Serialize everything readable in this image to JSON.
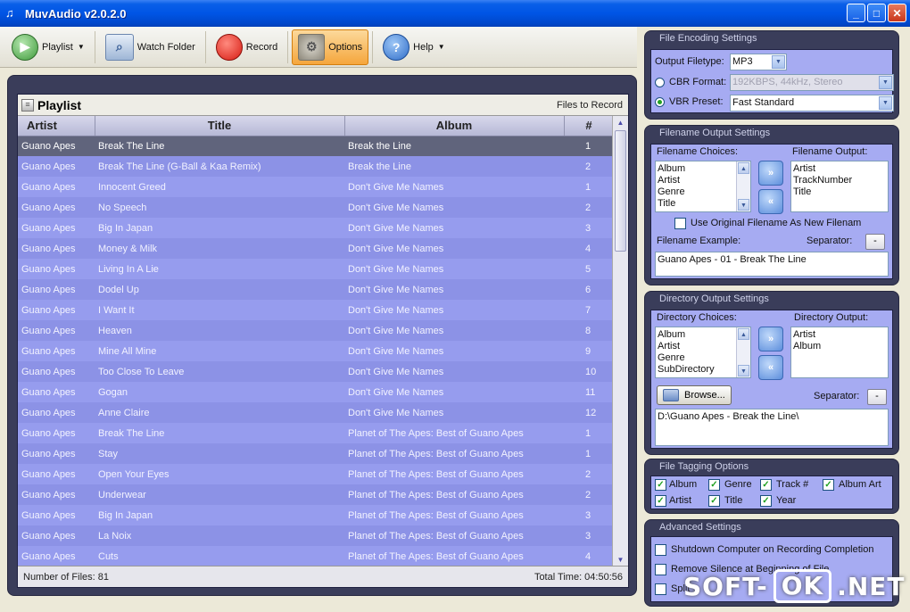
{
  "window": {
    "title": "MuvAudio v2.0.2.0"
  },
  "toolbar": {
    "playlist": "Playlist",
    "watch_folder": "Watch Folder",
    "record": "Record",
    "options": "Options",
    "help": "Help"
  },
  "playlist": {
    "title": "Playlist",
    "files_to_record": "Files to Record",
    "columns": {
      "artist": "Artist",
      "title": "Title",
      "album": "Album",
      "num": "#"
    },
    "rows": [
      [
        "Guano Apes",
        "Break The Line",
        "Break the Line",
        "1"
      ],
      [
        "Guano Apes",
        "Break The Line (G-Ball & Kaa Remix)",
        "Break the Line",
        "2"
      ],
      [
        "Guano Apes",
        "Innocent Greed",
        "Don't Give Me Names",
        "1"
      ],
      [
        "Guano Apes",
        "No Speech",
        "Don't Give Me Names",
        "2"
      ],
      [
        "Guano Apes",
        "Big In Japan",
        "Don't Give Me Names",
        "3"
      ],
      [
        "Guano Apes",
        "Money & Milk",
        "Don't Give Me Names",
        "4"
      ],
      [
        "Guano Apes",
        "Living In A Lie",
        "Don't Give Me Names",
        "5"
      ],
      [
        "Guano Apes",
        "Dodel Up",
        "Don't Give Me Names",
        "6"
      ],
      [
        "Guano Apes",
        "I Want It",
        "Don't Give Me Names",
        "7"
      ],
      [
        "Guano Apes",
        "Heaven",
        "Don't Give Me Names",
        "8"
      ],
      [
        "Guano Apes",
        "Mine All Mine",
        "Don't Give Me Names",
        "9"
      ],
      [
        "Guano Apes",
        "Too Close To Leave",
        "Don't Give Me Names",
        "10"
      ],
      [
        "Guano Apes",
        "Gogan",
        "Don't Give Me Names",
        "11"
      ],
      [
        "Guano Apes",
        "Anne Claire",
        "Don't Give Me Names",
        "12"
      ],
      [
        "Guano Apes",
        "Break The Line",
        "Planet of The Apes: Best of Guano Apes",
        "1"
      ],
      [
        "Guano Apes",
        "Stay",
        "Planet of The Apes: Best of Guano Apes",
        "1"
      ],
      [
        "Guano Apes",
        "Open Your Eyes",
        "Planet of The Apes: Best of Guano Apes",
        "2"
      ],
      [
        "Guano Apes",
        "Underwear",
        "Planet of The Apes: Best of Guano Apes",
        "2"
      ],
      [
        "Guano Apes",
        "Big In Japan",
        "Planet of The Apes: Best of Guano Apes",
        "3"
      ],
      [
        "Guano Apes",
        "La Noix",
        "Planet of The Apes: Best of Guano Apes",
        "3"
      ],
      [
        "Guano Apes",
        "Cuts",
        "Planet of The Apes: Best of Guano Apes",
        "4"
      ]
    ],
    "number_of_files": "Number of Files: 81",
    "total_time": "Total Time: 04:50:56"
  },
  "encoding": {
    "title": "File Encoding Settings",
    "output_filetype_label": "Output Filetype:",
    "output_filetype_value": "MP3",
    "cbr_label": "CBR Format:",
    "cbr_value": "192KBPS, 44kHz, Stereo",
    "vbr_label": "VBR Preset:",
    "vbr_value": "Fast Standard"
  },
  "filename": {
    "title": "Filename Output Settings",
    "choices_label": "Filename Choices:",
    "choices": [
      "Album",
      "Artist",
      "Genre",
      "Title"
    ],
    "output_label": "Filename Output:",
    "output": [
      "Artist",
      "TrackNumber",
      "Title"
    ],
    "use_original": "Use Original Filename As New Filenam",
    "example_label": "Filename Example:",
    "separator_label": "Separator:",
    "separator_value": "-",
    "example_value": "Guano Apes - 01 - Break The Line"
  },
  "directory": {
    "title": "Directory Output Settings",
    "choices_label": "Directory Choices:",
    "choices": [
      "Album",
      "Artist",
      "Genre",
      "SubDirectory"
    ],
    "output_label": "Directory Output:",
    "output": [
      "Artist",
      "Album"
    ],
    "browse": "Browse...",
    "separator_label": "Separator:",
    "separator_value": "-",
    "path_value": "D:\\Guano Apes - Break the Line\\"
  },
  "tagging": {
    "title": "File Tagging Options",
    "album": "Album",
    "genre": "Genre",
    "track": "Track #",
    "album_art": "Album Art",
    "artist": "Artist",
    "title_opt": "Title",
    "year": "Year"
  },
  "advanced": {
    "title": "Advanced Settings",
    "shutdown": "Shutdown Computer on Recording Completion",
    "remove_silence": "Remove Silence at Beginning of File",
    "split": "Split"
  },
  "watermark": {
    "part1": "SOFT-",
    "part2": "OK",
    "part3": ".NET"
  }
}
